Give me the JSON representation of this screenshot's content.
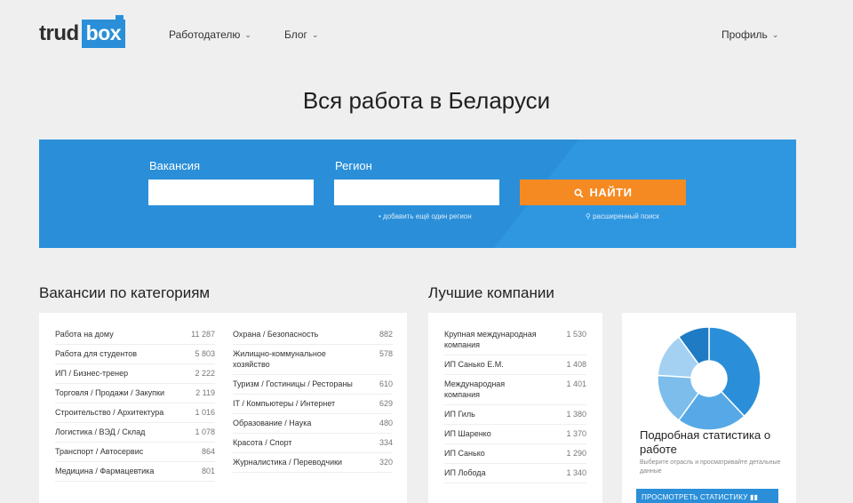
{
  "header": {
    "logo_part1": "trud",
    "logo_part2": "box",
    "nav": [
      {
        "label": "Работодателю"
      },
      {
        "label": "Блог"
      }
    ],
    "profile_label": "Профиль"
  },
  "page_title": "Вся работа в Беларуси",
  "search": {
    "vacancy_label": "Вакансия",
    "region_label": "Регион",
    "vacancy_value": "",
    "region_value": "",
    "find_label": "НАЙТИ",
    "add_region_link": "• добавить ещё один регион",
    "advanced_link": "расширенный поиск",
    "button_color": "#f58a22",
    "panel_color": "#2a8fd8"
  },
  "categories": {
    "title": "Вакансии по категориям",
    "left": [
      {
        "name": "Работа на дому",
        "count": "11 287"
      },
      {
        "name": "Работа для студентов",
        "count": "5 803"
      },
      {
        "name": "ИП / Бизнес-тренер",
        "count": "2 222"
      },
      {
        "name": "Торговля / Продажи / Закупки",
        "count": "2 119"
      },
      {
        "name": "Строительство / Архитектура",
        "count": "1 016"
      },
      {
        "name": "Логистика / ВЭД / Склад",
        "count": "1 078"
      },
      {
        "name": "Транспорт / Автосервис",
        "count": "864"
      },
      {
        "name": "Медицина / Фармацевтика",
        "count": "801"
      }
    ],
    "right": [
      {
        "name": "Охрана / Безопасность",
        "count": "882"
      },
      {
        "name": "Жилищно-коммунальное хозяйство",
        "count": "578"
      },
      {
        "name": "Туризм / Гостиницы / Рестораны",
        "count": "610"
      },
      {
        "name": "IT / Компьютеры / Интернет",
        "count": "629"
      },
      {
        "name": "Образование / Наука",
        "count": "480"
      },
      {
        "name": "Красота / Спорт",
        "count": "334"
      },
      {
        "name": "Журналистика / Переводчики",
        "count": "320"
      }
    ]
  },
  "companies": {
    "title": "Лучшие компании",
    "items": [
      {
        "name": "Крупная международная компания",
        "count": "1 530"
      },
      {
        "name": "ИП Санько Е.М.",
        "count": "1 408"
      },
      {
        "name": "Международная компания",
        "count": "1 401"
      },
      {
        "name": "ИП Гиль",
        "count": "1 380"
      },
      {
        "name": "ИП Шаренко",
        "count": "1 370"
      },
      {
        "name": "ИП Санько",
        "count": "1 290"
      },
      {
        "name": "ИП Лобода",
        "count": "1 340"
      }
    ]
  },
  "stats": {
    "title": "Подробная статистика о работе",
    "description": "Выберите отрасль и просматривайте детальные данные",
    "button_label": "ПРОСМОТРЕТЬ СТАТИСТИКУ",
    "pie": {
      "values": [
        38,
        22,
        16,
        14,
        10
      ],
      "colors": [
        "#2a8fd8",
        "#56a9e6",
        "#7cbdec",
        "#a4d1f2",
        "#1f7bc4"
      ]
    }
  }
}
